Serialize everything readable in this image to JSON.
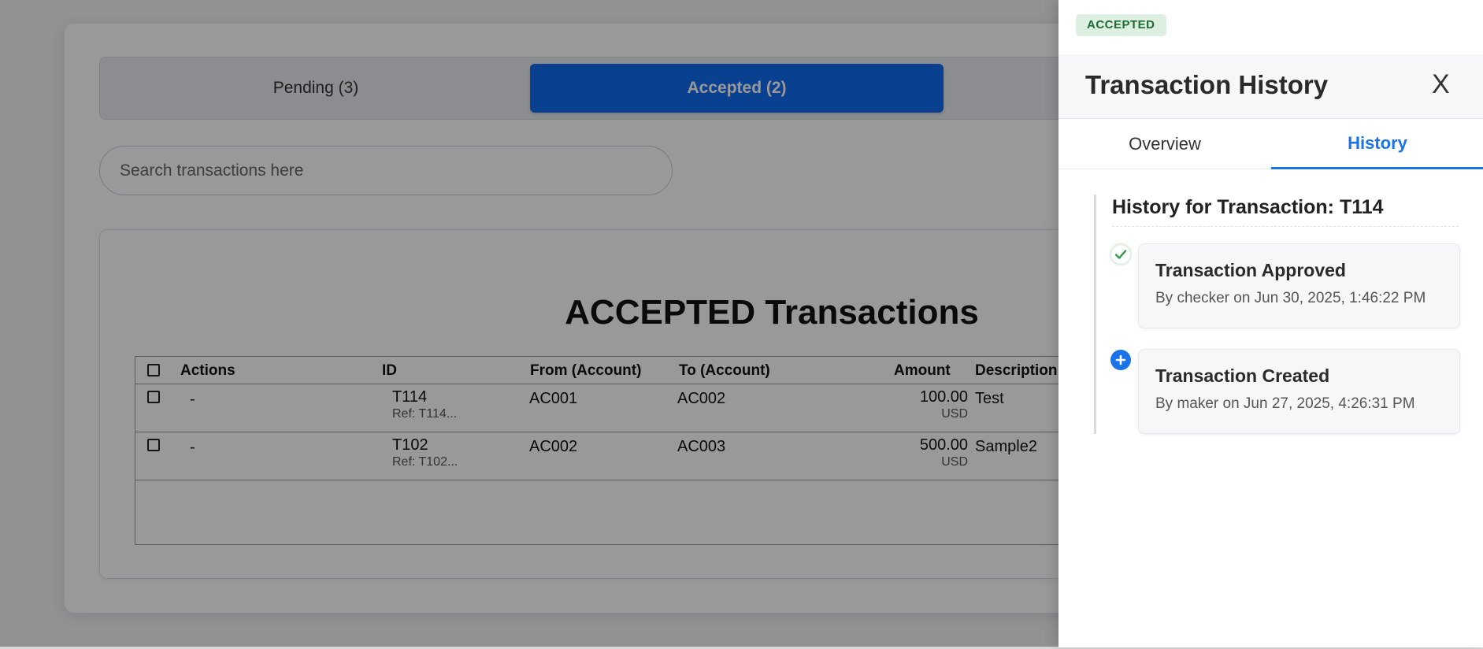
{
  "tabs": {
    "pending": "Pending (3)",
    "accepted": "Accepted (2)"
  },
  "search": {
    "placeholder": "Search transactions here"
  },
  "table": {
    "title": "ACCEPTED Transactions",
    "headers": {
      "actions": "Actions",
      "id": "ID",
      "from": "From (Account)",
      "to": "To (Account)",
      "amount": "Amount",
      "description": "Description"
    },
    "rows": [
      {
        "actions": "-",
        "id": "T114",
        "ref": "Ref: T114...",
        "from": "AC001",
        "to": "AC002",
        "amount": "100.00",
        "currency": "USD",
        "description": "Test"
      },
      {
        "actions": "-",
        "id": "T102",
        "ref": "Ref: T102...",
        "from": "AC002",
        "to": "AC003",
        "amount": "500.00",
        "currency": "USD",
        "description": "Sample2"
      }
    ]
  },
  "panel": {
    "status_badge": "ACCEPTED",
    "title": "Transaction History",
    "close_label": "X",
    "tabs": {
      "overview": "Overview",
      "history": "History"
    },
    "history": {
      "heading": "History for Transaction: T114",
      "events": [
        {
          "title": "Transaction Approved",
          "meta": "By checker on Jun 30, 2025, 1:46:22 PM",
          "icon": "check-icon"
        },
        {
          "title": "Transaction Created",
          "meta": "By maker on Jun 27, 2025, 4:26:31 PM",
          "icon": "plus-circle-icon"
        }
      ]
    }
  },
  "colors": {
    "accent": "#1a73e8",
    "active_tab": "#0f6cf0",
    "badge_bg": "#dcefe0",
    "badge_text": "#1e6b33",
    "success": "#2e9b48"
  }
}
